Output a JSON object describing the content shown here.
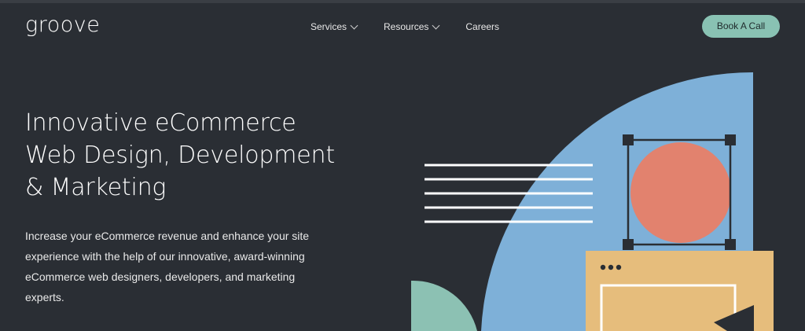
{
  "header": {
    "logo": "groove",
    "nav": {
      "services": "Services",
      "resources": "Resources",
      "careers": "Careers"
    },
    "cta": "Book A Call"
  },
  "hero": {
    "title_lines": [
      "Innovative eCommerce",
      "Web Design, Development",
      "& Marketing"
    ],
    "subtitle_lines": [
      "Increase your eCommerce revenue and enhance your site",
      "experience with the help of our innovative, award-winning",
      "eCommerce web designers, developers, and marketing",
      "experts."
    ]
  },
  "colors": {
    "background": "#2a2e34",
    "cta": "#89c2b3",
    "blue": "#7eb0d8",
    "coral": "#e2826e",
    "sand": "#e6bd7c",
    "teal": "#8cc1b3"
  }
}
